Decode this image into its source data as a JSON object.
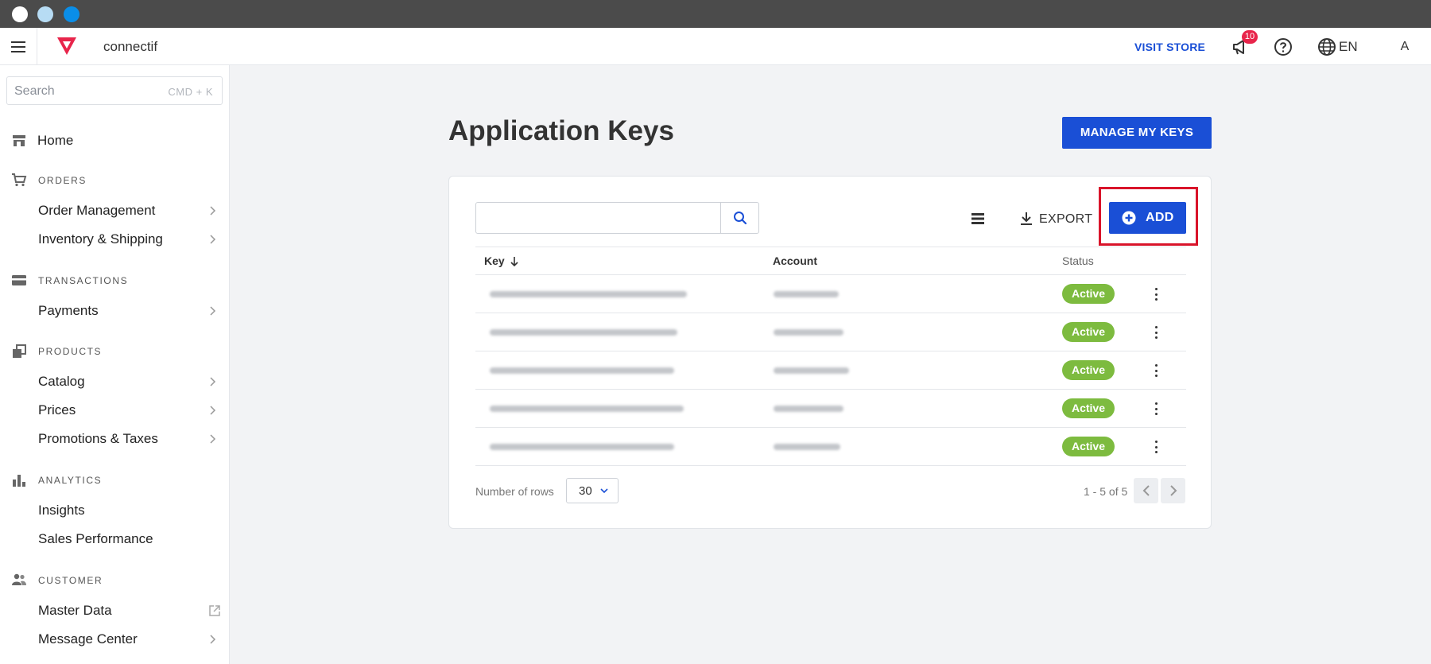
{
  "header": {
    "store_name": "connectif",
    "visit_store": "VISIT STORE",
    "notification_count": "10",
    "language": "EN",
    "avatar_initial": "A",
    "accent_color": "#1a4fd6",
    "logo_color": "#e8254b"
  },
  "sidebar": {
    "search_placeholder": "Search",
    "search_shortcut": "CMD + K",
    "home": "Home",
    "sections": {
      "orders": {
        "title": "ORDERS",
        "items": [
          "Order Management",
          "Inventory & Shipping"
        ]
      },
      "transactions": {
        "title": "TRANSACTIONS",
        "items": [
          "Payments"
        ]
      },
      "products": {
        "title": "PRODUCTS",
        "items": [
          "Catalog",
          "Prices",
          "Promotions & Taxes"
        ]
      },
      "analytics": {
        "title": "ANALYTICS",
        "items": [
          "Insights",
          "Sales Performance"
        ]
      },
      "customer": {
        "title": "CUSTOMER",
        "items": [
          "Master Data",
          "Message Center"
        ]
      }
    }
  },
  "main": {
    "title": "Application Keys",
    "manage_keys": "MANAGE MY KEYS",
    "toolbar": {
      "export": "EXPORT",
      "add": "ADD"
    },
    "table": {
      "columns": {
        "key": "Key",
        "account": "Account",
        "status": "Status"
      },
      "rows": [
        {
          "status": "Active"
        },
        {
          "status": "Active"
        },
        {
          "status": "Active"
        },
        {
          "status": "Active"
        },
        {
          "status": "Active"
        }
      ]
    },
    "footer": {
      "rows_label": "Number of rows",
      "rows_value": "30",
      "range": "1 - 5 of 5"
    },
    "status_color": "#7dbb3f"
  }
}
